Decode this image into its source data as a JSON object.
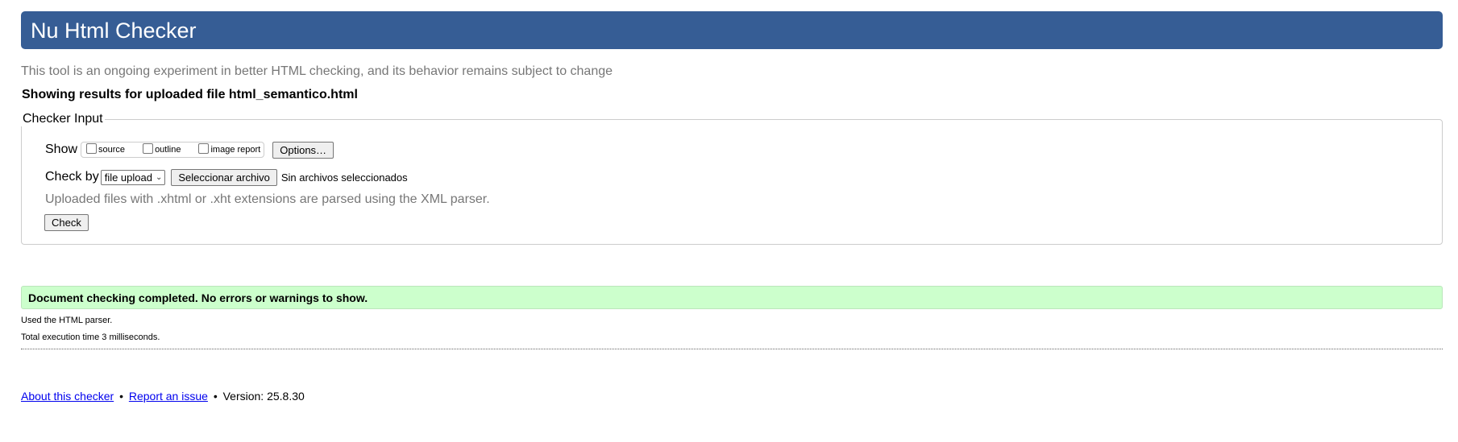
{
  "header": {
    "title": "Nu Html Checker"
  },
  "subtitle": "This tool is an ongoing experiment in better HTML checking, and its behavior remains subject to change",
  "results_heading": "Showing results for uploaded file html_semantico.html",
  "checker_input": {
    "legend": "Checker Input",
    "show_label": "Show",
    "checkboxes": [
      {
        "label": "source",
        "checked": false
      },
      {
        "label": "outline",
        "checked": false
      },
      {
        "label": "image report",
        "checked": false
      }
    ],
    "options_button": "Options…",
    "check_by_label": "Check by",
    "check_by_select": "file upload",
    "file_button": "Seleccionar archivo",
    "file_status": "Sin archivos seleccionados",
    "note": "Uploaded files with .xhtml or .xht extensions are parsed using the XML parser.",
    "check_button": "Check"
  },
  "result": {
    "success_message": "Document checking completed. No errors or warnings to show.",
    "parser_info": "Used the HTML parser.",
    "timing_info": "Total execution time 3 milliseconds."
  },
  "footer": {
    "about_link": "About this checker",
    "separator": "•",
    "report_link": "Report an issue",
    "version": "Version: 25.8.30"
  },
  "colors": {
    "header_bg": "#365d95",
    "success_bg": "#ccffcc",
    "muted_text": "#777777",
    "link": "#0000ee"
  }
}
